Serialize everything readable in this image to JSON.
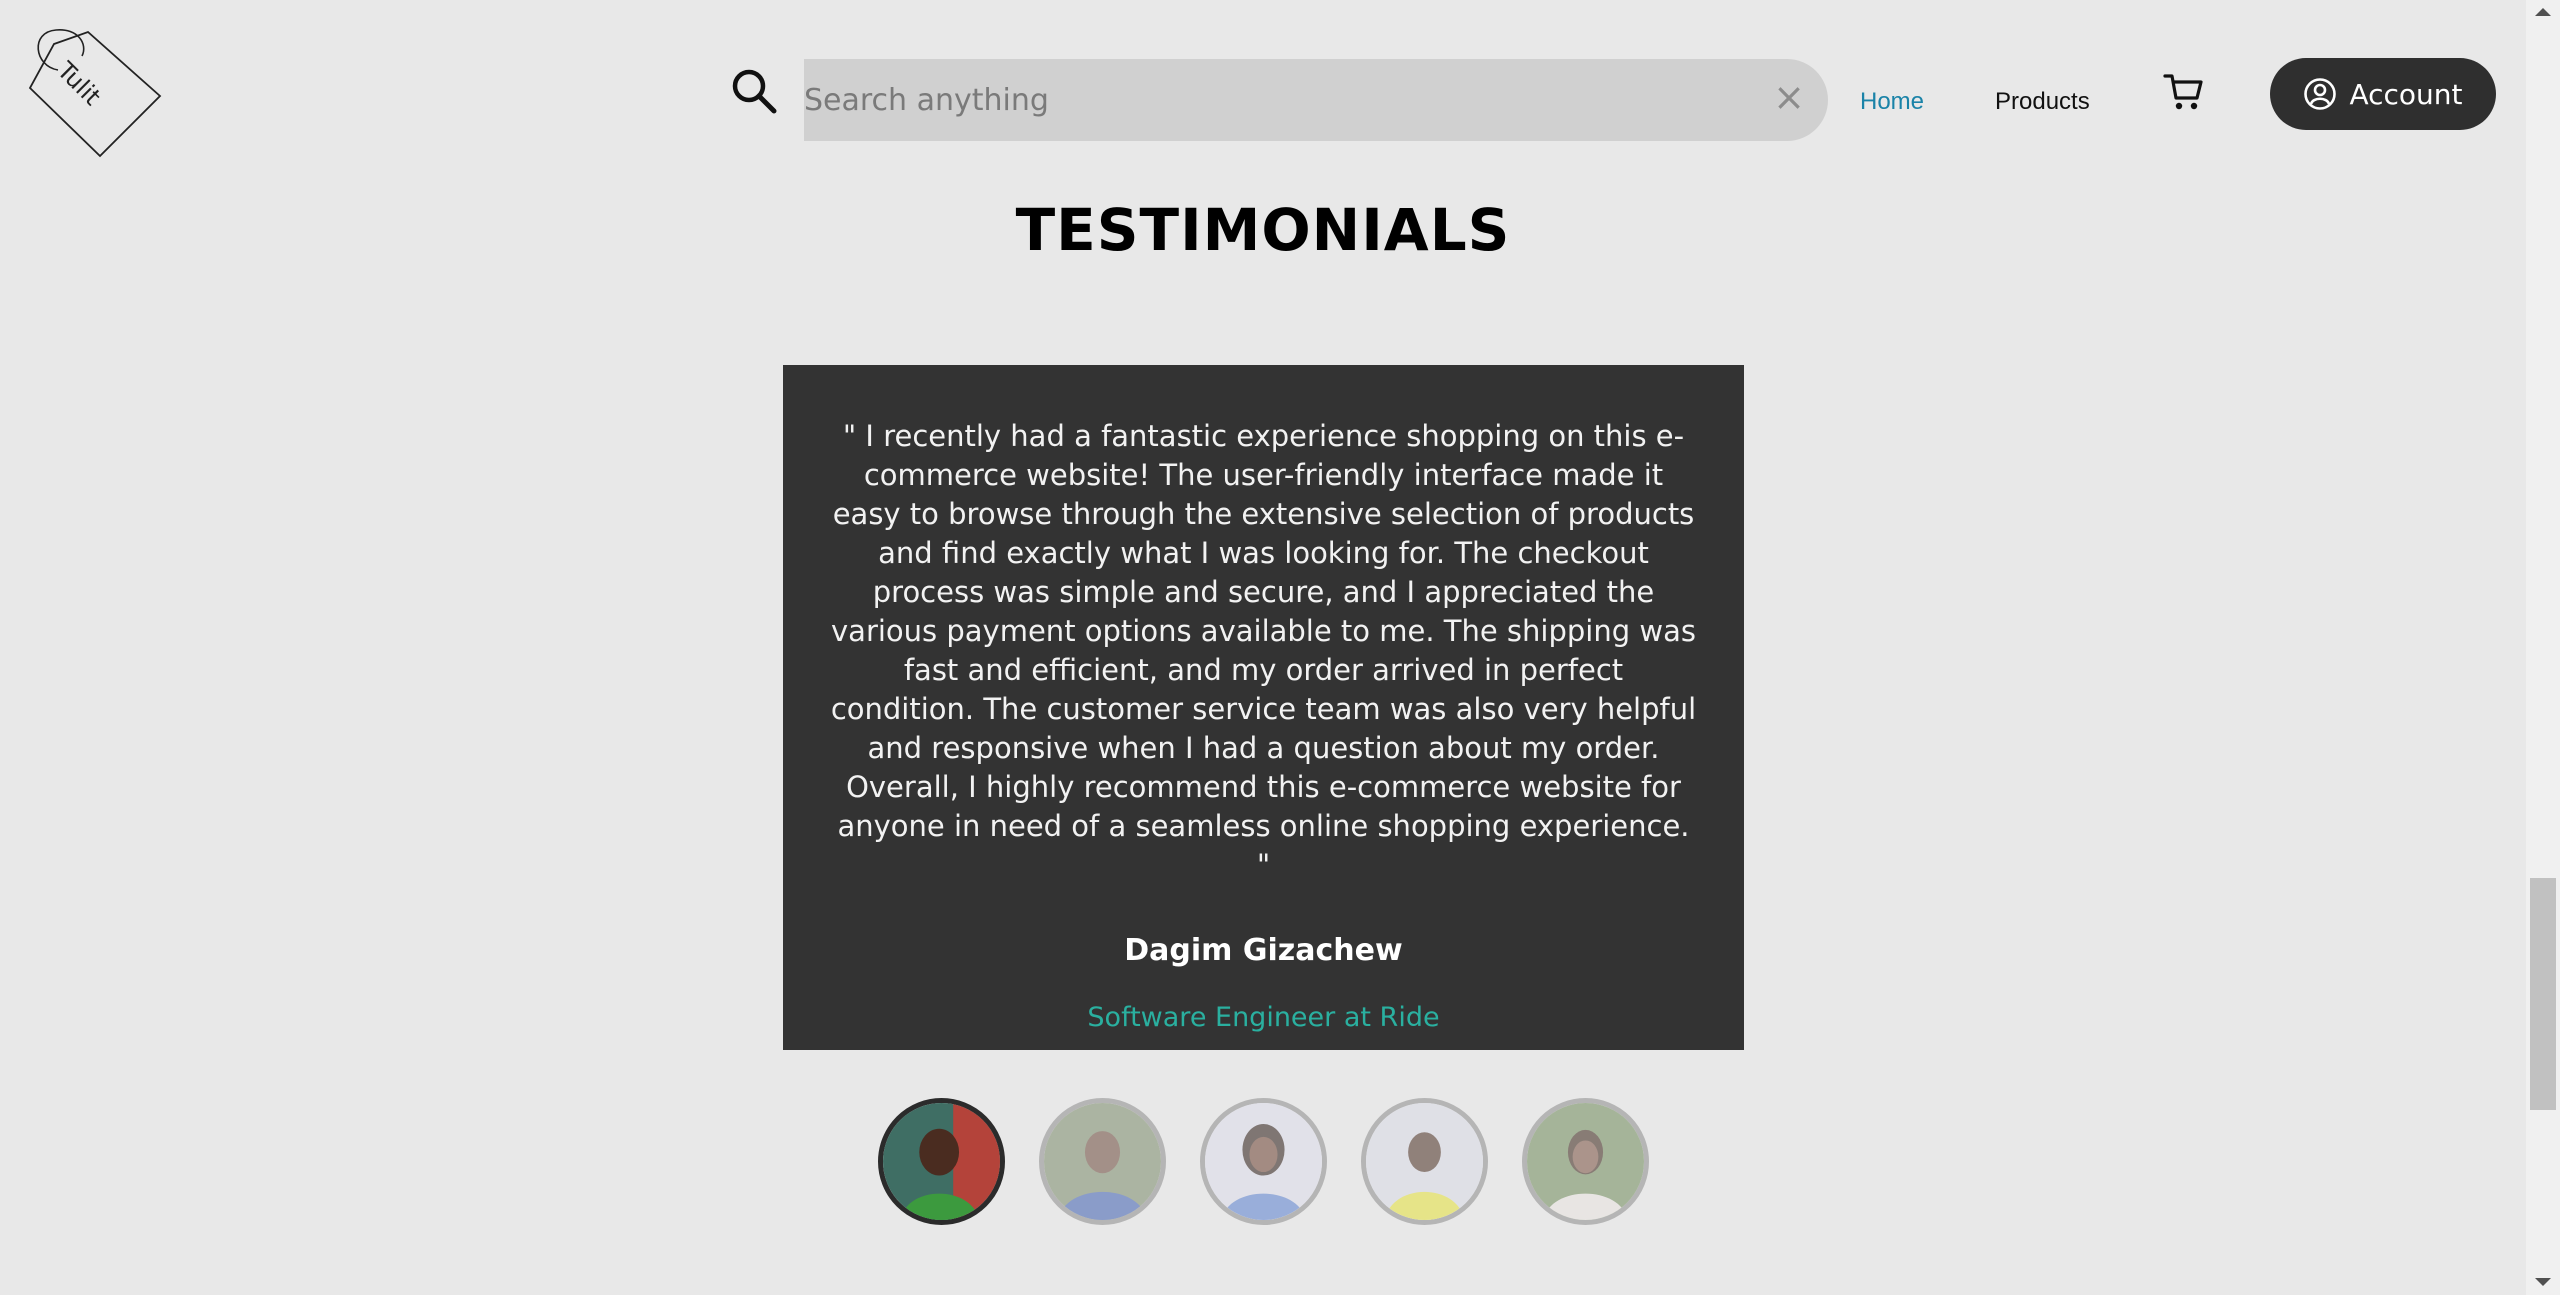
{
  "header": {
    "logo_text": "Tulit",
    "search": {
      "placeholder": "Search anything",
      "value": "",
      "clear_glyph": "×"
    },
    "nav": [
      {
        "label": "Home",
        "active": true
      },
      {
        "label": "Products",
        "active": false
      }
    ],
    "account_label": "Account"
  },
  "testimonials": {
    "title": "TESTIMONIALS",
    "active_index": 0,
    "quote": "\" I recently had a fantastic experience shopping on this e-commerce website! The user-friendly interface made it easy to browse through the extensive selection of products and find exactly what I was looking for. The checkout process was simple and secure, and I appreciated the various payment options available to me. The shipping was fast and efficient, and my order arrived in perfect condition. The customer service team was also very helpful and responsive when I had a question about my order. Overall, I highly recommend this e-commerce website for anyone in need of a seamless online shopping experience. \"",
    "author": "Dagim Gizachew",
    "role": "Software Engineer at Ride",
    "avatars_count": 5
  },
  "colors": {
    "background": "#e8e8e8",
    "card": "#333333",
    "accent_teal": "#2ab0a0",
    "nav_active": "#1a83a8",
    "search_bg": "#d0d0d0",
    "account_bg": "#2f2f2f"
  }
}
